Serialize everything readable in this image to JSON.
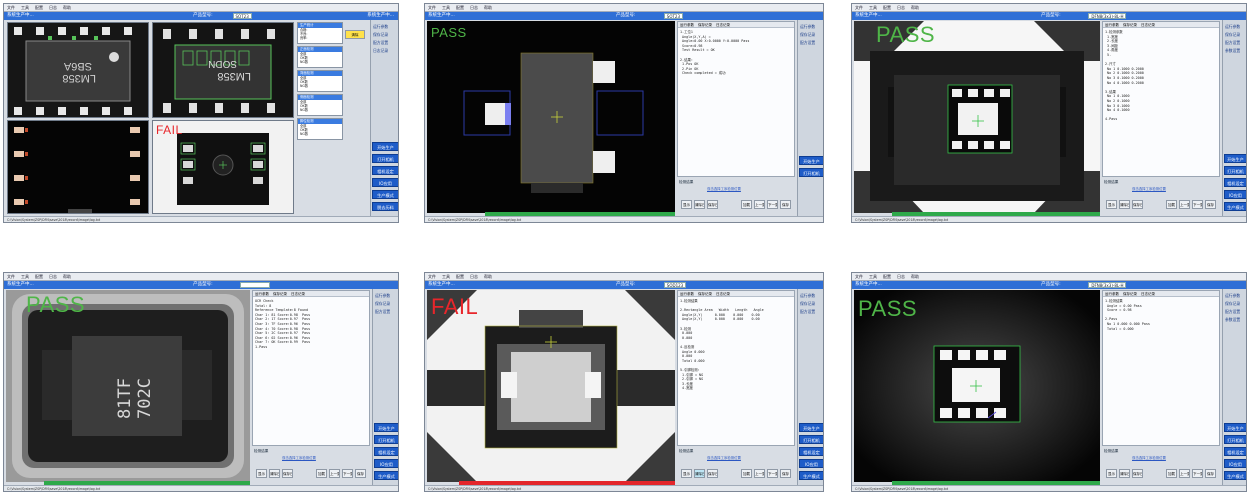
{
  "common": {
    "menu": [
      "文件",
      "工具",
      "配置",
      "日志",
      "帮助"
    ],
    "product_label": "产品型号:",
    "run_state": "系统生产中...",
    "side_buttons": [
      "开始生产",
      "打开相机",
      "相机设定",
      "IO应用",
      "生产模式",
      "脱去历料"
    ],
    "side_items": [
      "运行参数",
      "保存记录",
      "配方设置",
      "日志记录",
      "参数设置"
    ],
    "results_title": "检测结果",
    "link_text": "双击选择工序检测位置",
    "status_text": "C:\\Vision\\System\\ZSP\\DFN\\save\\2018\\record\\image\\log.txt",
    "tools": [
      "显示",
      "清除日志",
      "保存日志",
      "加载",
      "上一张",
      "下一张",
      "保存"
    ]
  },
  "screens": [
    {
      "id": "s1",
      "product": "SOT23",
      "tiles": [
        {
          "verdict": "",
          "markings": [
            "LM358",
            "SB6A"
          ]
        },
        {
          "verdict": "",
          "markings": [
            "LM358",
            "SODN"
          ]
        },
        {
          "verdict": "",
          "markings": []
        },
        {
          "verdict": "FAIL",
          "markings": []
        }
      ],
      "stats": [
        {
          "title": "生产统计",
          "rows": [
            "合格:",
            "不良:",
            "良率:"
          ]
        },
        {
          "title": "正面检测",
          "rows": [
            "全部",
            "OK数",
            "NG数"
          ]
        },
        {
          "title": "背面检测",
          "rows": [
            "全部",
            "OK数",
            "NG数"
          ]
        },
        {
          "title": "侧面检测",
          "rows": [
            "全部",
            "OK数",
            "NG数"
          ]
        },
        {
          "title": "脚位检测",
          "rows": [
            "全部",
            "OK数",
            "NG数"
          ]
        }
      ],
      "clear_label": "清除"
    },
    {
      "id": "s2",
      "product": "SOT23",
      "verdict": "PASS",
      "log": [
        "1.工位1",
        " Angle(X,Y,A) =",
        " Angle=0.00 X:0.0000 Y:0.0000 Pass",
        " Score=0.98",
        " Test Result = OK",
        "",
        "2.结果:",
        " 1.Pos OK",
        " 2.Pin OK",
        " Check completed = 成功"
      ]
    },
    {
      "id": "s3",
      "product": "DFN8(3x3)-8L-H",
      "verdict": "PASS",
      "log": [
        "1.检测参数",
        " 1.宽度",
        " 2.长度",
        " 3.间距",
        " 4.角度",
        " 5.",
        "",
        "2.尺寸",
        " No 1 0.1000 0.2000",
        " No 2 0.1000 0.2000",
        " No 3 0.1000 0.2000",
        " No 4 0.1000 0.2000",
        "",
        "3.结果",
        " No 1 0.1000",
        " No 2 0.1000",
        " No 3 0.1000",
        " No 4 0.1000",
        "",
        "4.Pass"
      ]
    },
    {
      "id": "s4",
      "product": "",
      "verdict": "PASS",
      "marking": [
        "81TF",
        "702C"
      ],
      "log": [
        "OCR Check",
        "Total: 8",
        "Reference Template:8 Found",
        "Char 1: 81 Score:0.98  Pass",
        "Char 2: 1T Score:0.97  Pass",
        "Char 3: TF Score:0.96  Pass",
        "Char 4: 70 Score:0.98  Pass",
        "Char 5: 2C Score:0.97  Pass",
        "Char 6: 02 Score:0.96  Pass",
        "Char 7: OK Score:0.99  Pass",
        "1.Pass"
      ]
    },
    {
      "id": "s5",
      "product": "SOD123",
      "verdict": "FAIL",
      "log": [
        "1.检测结果",
        "",
        "2.Rectangle Area   Width   Length   Angle",
        " Angle(X,Y)      0.000    0.000    0.00",
        " Angle(X,Y)      0.000    0.000    0.00",
        "",
        "3.检测",
        " 0.000",
        " 0.000",
        "",
        "4.反检测",
        " Angle 0.000",
        " 0.000",
        " Total 0.000",
        "",
        "5.引脚检测:",
        " 1.引脚 = NG",
        " 2.引脚 = NG",
        " 3.长度",
        " 4.宽度"
      ]
    },
    {
      "id": "s6",
      "product": "DFN8(3x3)-8L-H",
      "verdict": "PASS",
      "log": [
        "1.检测结果",
        " Angle = 0.00 Pass",
        " Score = 0.98",
        "",
        "2.Pass",
        " No 1 0.000 0.000 Pass",
        " Total = 0.000"
      ]
    }
  ]
}
